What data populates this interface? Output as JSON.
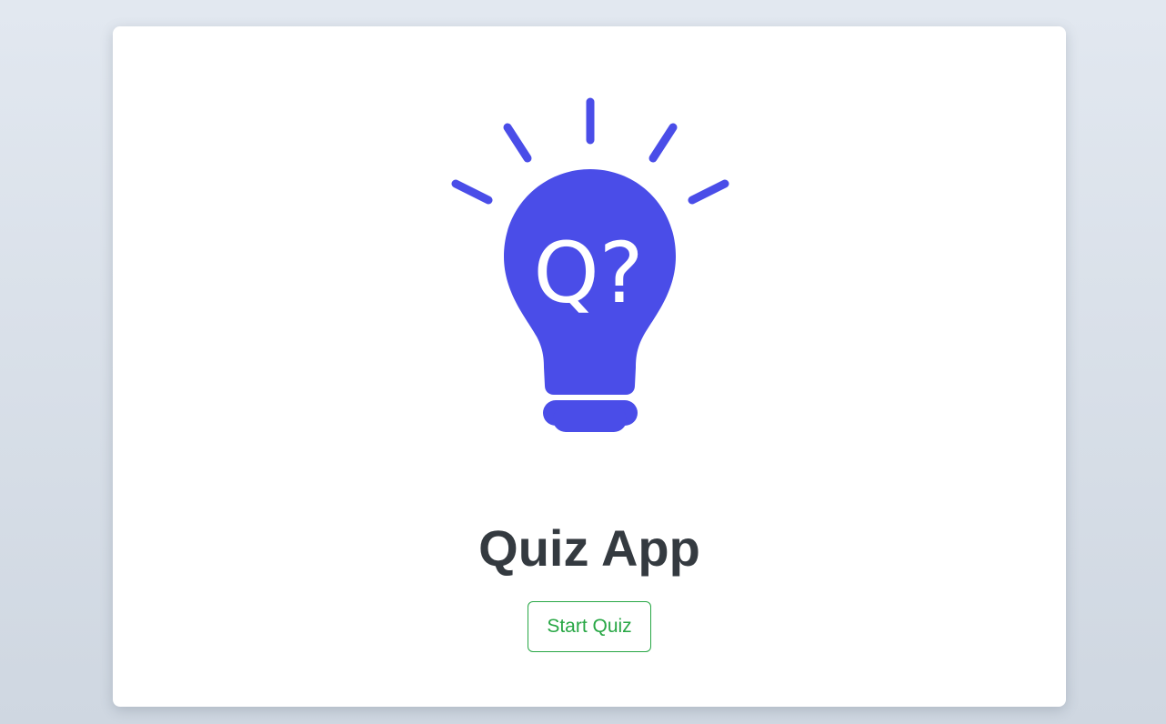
{
  "app": {
    "title": "Quiz App",
    "logo_icon": "lightbulb-question-icon",
    "logo_text": "Q?",
    "accent_color": "#4a4de8",
    "title_color": "#343a40",
    "button_color": "#28a745",
    "background_color": "#e2e8f0"
  },
  "actions": {
    "start_label": "Start Quiz"
  }
}
